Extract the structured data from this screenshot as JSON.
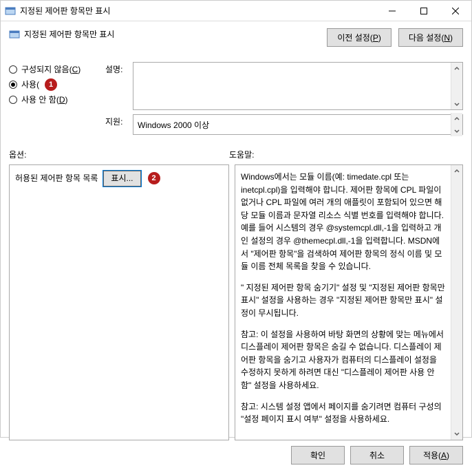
{
  "window": {
    "title": "지정된 제어판 항목만 표시"
  },
  "header": {
    "title": "지정된 제어판 항목만 표시",
    "prev_btn": "이전 설정(P)",
    "next_btn": "다음 설정(N)"
  },
  "radios": {
    "not_configured": "구성되지 않음(C)",
    "enabled": "사용(",
    "disabled": "사용 안 함(D)"
  },
  "info": {
    "desc_label": "설명:",
    "desc_text": "",
    "support_label": "지원:",
    "support_text": "Windows 2000 이상"
  },
  "labels": {
    "options": "옵션:",
    "help": "도움말:"
  },
  "options_pane": {
    "allowed_list_label": "허용된 제어판 항목 목록",
    "show_btn": "표시..."
  },
  "help": {
    "p1": "Windows에서는 모듈 이름(예: timedate.cpl 또는 inetcpl.cpl)을 입력해야 합니다. 제어판 항목에 CPL 파일이 없거나 CPL 파일에 여러 개의 애플릿이 포함되어 있으면 해당 모듈 이름과 문자열 리소스 식별 번호를 입력해야 합니다. 예를 들어 시스템의 경우 @systemcpl.dll,-1을 입력하고 개인 설정의 경우 @themecpl.dll,-1을 입력합니다. MSDN에서 \"제어판 항목\"을 검색하여 제어판 항목의 정식 이름 및 모듈 이름 전체 목록을 찾을 수 있습니다.",
    "p2": "\" 지정된 제어판 항목 숨기기\" 설정 및 \"지정된 제어판 항목만 표시\" 설정을 사용하는 경우 \"지정된 제어판 항목만 표시\" 설정이 무시됩니다.",
    "p3": "참고: 이 설정을 사용하여 바탕 화면의 상황에 맞는 메뉴에서 디스플레이 제어판 항목은 숨길 수 없습니다. 디스플레이 제어판 항목을 숨기고 사용자가 컴퓨터의 디스플레이 설정을 수정하지 못하게 하려면 대신 \"디스플레이 제어판 사용 안 함\" 설정을 사용하세요.",
    "p4": "참고: 시스템 설정 앱에서 페이지를 숨기려면 컴퓨터 구성의 \"설정 페이지 표시 여부\" 설정을 사용하세요."
  },
  "buttons": {
    "ok": "확인",
    "cancel": "취소",
    "apply": "적용(A)"
  },
  "badges": {
    "one": "1",
    "two": "2"
  }
}
